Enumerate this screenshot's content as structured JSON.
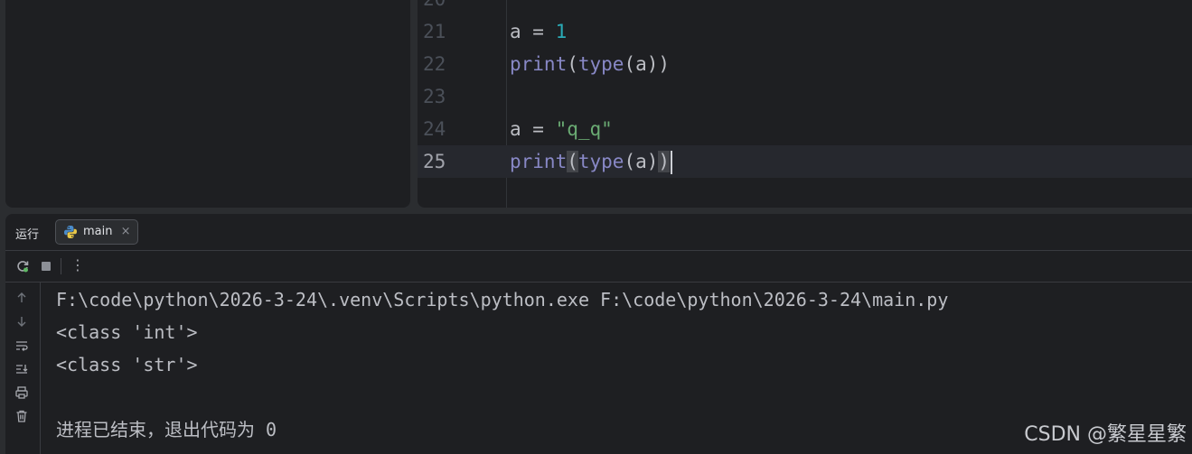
{
  "editor": {
    "lines": [
      {
        "no": "20",
        "text": ""
      },
      {
        "no": "21",
        "text": "a = 1"
      },
      {
        "no": "22",
        "text": "print(type(a))"
      },
      {
        "no": "23",
        "text": ""
      },
      {
        "no": "24",
        "text": "a = \"q_q\""
      },
      {
        "no": "25",
        "text": "print(type(a))"
      }
    ],
    "current_line": "25"
  },
  "run_panel": {
    "title": "运行",
    "tab_label": "main",
    "tab_close": "×",
    "toolbar_more": "⋮"
  },
  "console": {
    "lines": [
      "F:\\code\\python\\2026-3-24\\.venv\\Scripts\\python.exe F:\\code\\python\\2026-3-24\\main.py",
      "<class 'int'>",
      "<class 'str'>",
      "",
      "进程已结束，退出代码为 0"
    ]
  },
  "watermark": "CSDN @繁星星繁",
  "colors": {
    "background": "#1e1f22",
    "builtin": "#8888c6",
    "number": "#2aacb8",
    "string": "#6aab73"
  }
}
